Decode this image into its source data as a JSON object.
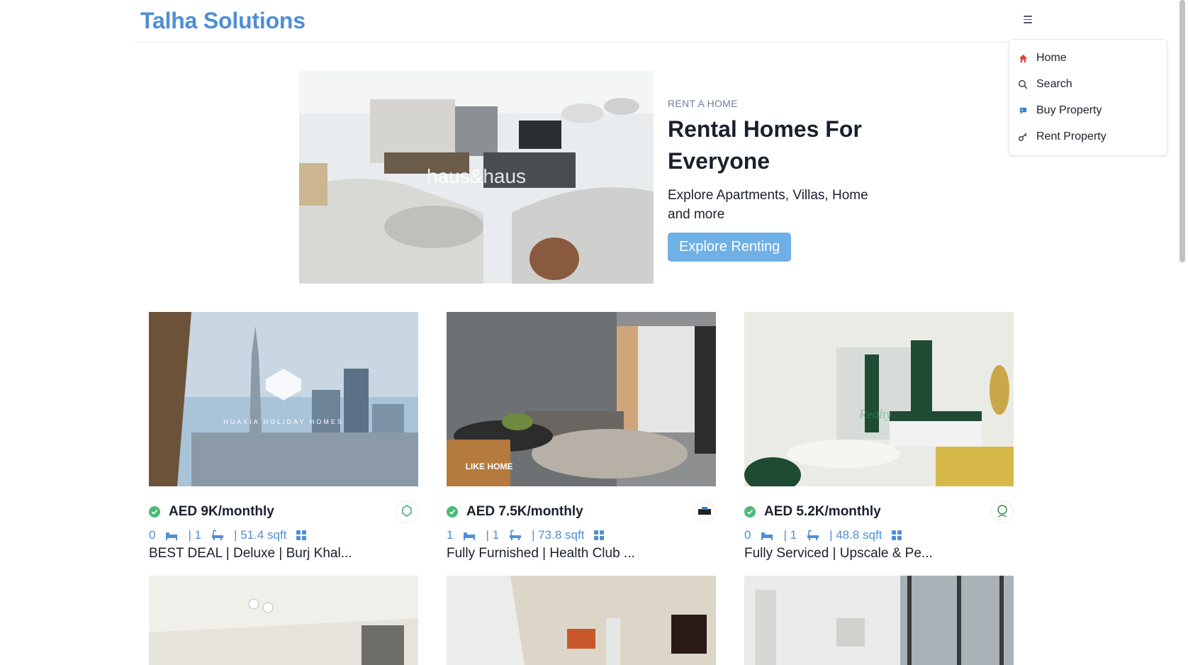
{
  "brand": "Talha Solutions",
  "menu": {
    "items": [
      {
        "label": "Home",
        "icon": "home-icon"
      },
      {
        "label": "Search",
        "icon": "search-icon"
      },
      {
        "label": "Buy Property",
        "icon": "flag-icon"
      },
      {
        "label": "Rent Property",
        "icon": "key-icon"
      }
    ]
  },
  "hero": {
    "subtitle": "RENT A HOME",
    "title": "Rental Homes For Everyone",
    "description": "Explore Apartments, Villas, Home and more",
    "button": "Explore Renting",
    "image_watermark": "haus&haus"
  },
  "listings": [
    {
      "price": "AED 9K/monthly",
      "rooms": "0",
      "baths": "| 1",
      "area": "| 51.4 sqft",
      "title": "BEST DEAL | Deluxe | Burj Khal...",
      "watermark": "HUAXIA HOLIDAY HOMES"
    },
    {
      "price": "AED 7.5K/monthly",
      "rooms": "1",
      "baths": "| 1",
      "area": "| 73.8 sqft",
      "title": "Fully Furnished | Health Club ...",
      "watermark": "LIKE HOME"
    },
    {
      "price": "AED 5.2K/monthly",
      "rooms": "0",
      "baths": "| 1",
      "area": "| 48.8 sqft",
      "title": "Fully Serviced | Upscale & Pe...",
      "watermark": "Realty"
    }
  ],
  "colors": {
    "brand": "#4f8fd4",
    "button": "#6fb0e6",
    "verified": "#48bb78"
  }
}
